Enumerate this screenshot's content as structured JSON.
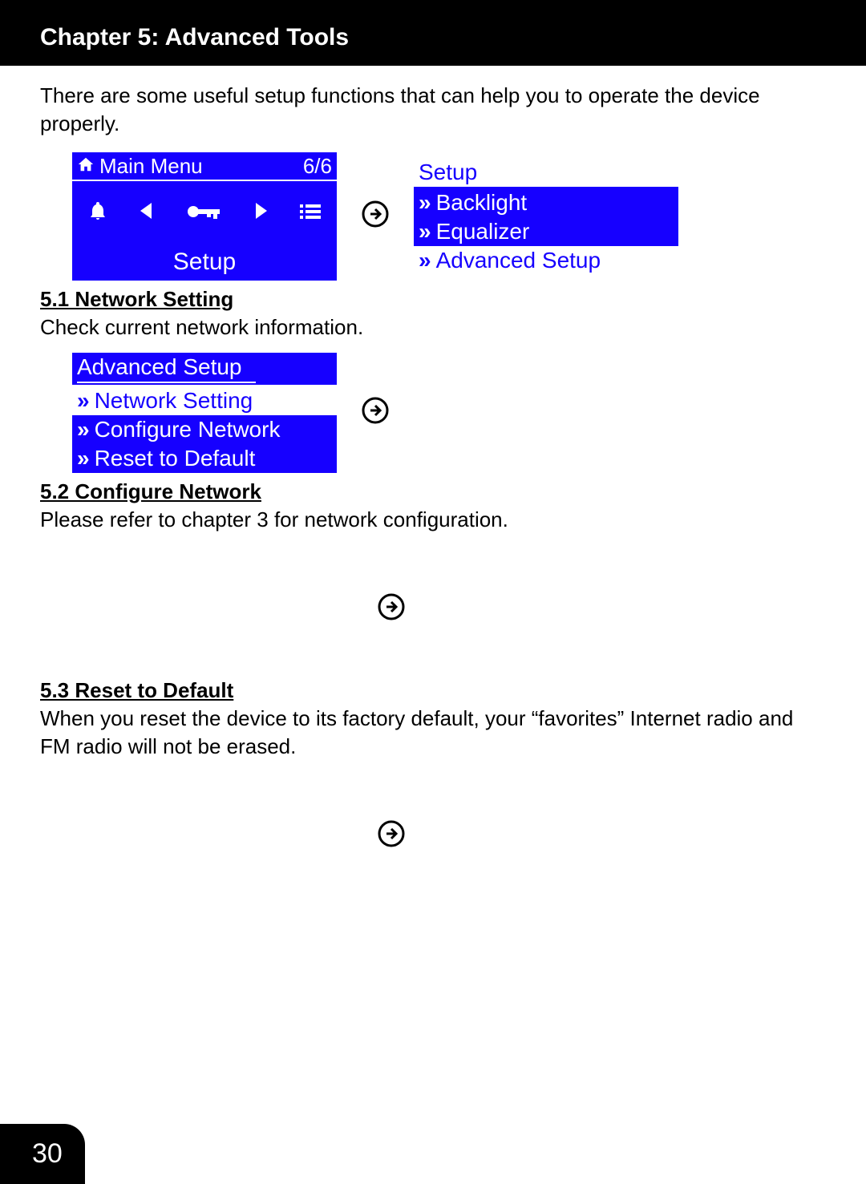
{
  "chapter_title": "Chapter 5: Advanced Tools",
  "intro": "There are some useful setup functions that can help you to operate the device properly.",
  "main_menu_screen": {
    "title": "Main Menu",
    "counter": "6/6",
    "footer": "Setup"
  },
  "setup_list": {
    "head": "Setup",
    "items": [
      "Backlight",
      "Equalizer",
      "Advanced Setup"
    ],
    "selected_index": 2
  },
  "section_5_1": {
    "heading": "5.1 Network Setting",
    "body": "Check current network information."
  },
  "advanced_setup_list": {
    "head": "Advanced Setup",
    "items": [
      "Network Setting",
      "Configure Network",
      "Reset to Default"
    ],
    "selected_index": 0
  },
  "section_5_2": {
    "heading": "5.2 Configure Network",
    "body": "Please refer to chapter 3 for network configuration."
  },
  "section_5_3": {
    "heading": "5.3 Reset to Default",
    "body": "When you reset the device to its factory default, your “favorites” Internet radio and FM radio will not be erased."
  },
  "page_number": "30"
}
